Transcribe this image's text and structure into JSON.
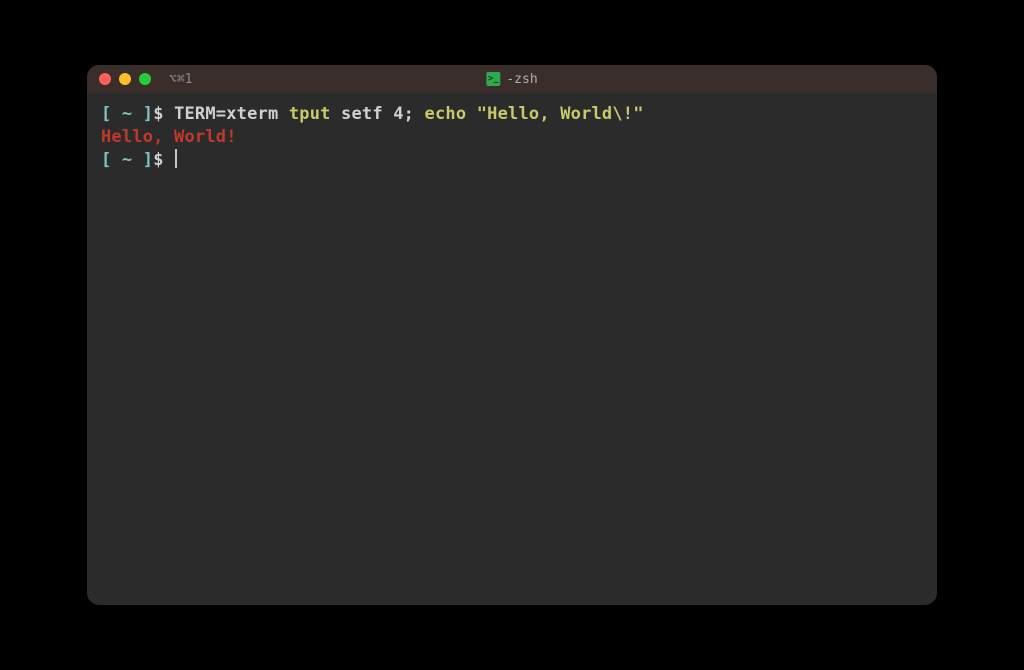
{
  "titlebar": {
    "tab_label": "⌥⌘1",
    "process_name": "-zsh"
  },
  "colors": {
    "bg": "#2b2b2b",
    "titlebar_bg": "#3a2e2a",
    "close": "#ff5f56",
    "minimize": "#ffbd2e",
    "maximize": "#27c93f",
    "bracket": "#7cc5c5",
    "command": "#c9c96a",
    "string": "#c9c96a",
    "output_red": "#c0392b",
    "text": "#d0d0d0"
  },
  "lines": {
    "l1": {
      "bracket_open": "[",
      "cwd": "~",
      "bracket_close": "]",
      "dollar": "$",
      "envassign": "TERM=xterm",
      "cmd1": "tput",
      "arg1": "setf 4",
      "sep": ";",
      "cmd2": "echo",
      "str": "\"Hello, World\\!\""
    },
    "l2": {
      "output": "Hello, World!"
    },
    "l3": {
      "bracket_open": "[",
      "cwd": "~",
      "bracket_close": "]",
      "dollar": "$"
    }
  }
}
